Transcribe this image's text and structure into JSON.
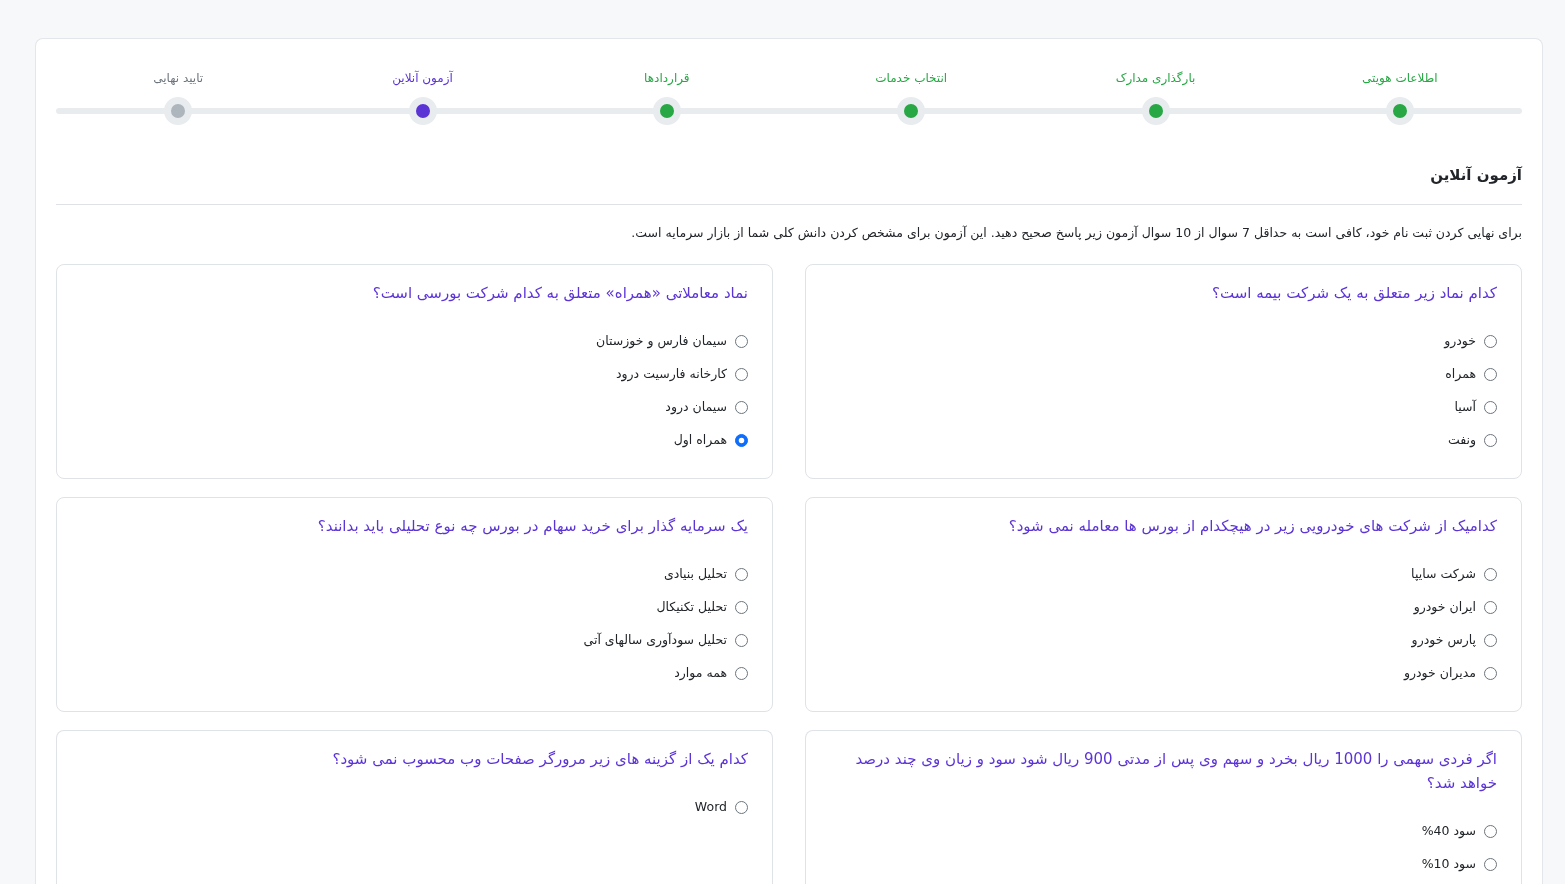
{
  "steps": [
    {
      "label": "اطلاعات هویتی",
      "completed": true,
      "selected": false
    },
    {
      "label": "بارگذاری مدارک",
      "completed": true,
      "selected": false
    },
    {
      "label": "انتخاب خدمات",
      "completed": true,
      "selected": false
    },
    {
      "label": "قراردادها",
      "completed": true,
      "selected": false
    },
    {
      "label": "آزمون آنلاین",
      "completed": false,
      "selected": true
    },
    {
      "label": "تایید نهایی",
      "completed": false,
      "selected": false
    }
  ],
  "section": {
    "title": "آزمون آنلاین",
    "intro": "برای نهایی کردن ثبت نام خود، کافی است به حداقل 7 سوال از 10 سوال آزمون زیر پاسخ صحیح دهید. این آزمون برای مشخص کردن دانش کلی شما از بازار سرمایه است."
  },
  "questions": [
    {
      "text": "کدام نماد زیر متعلق به یک شرکت بیمه است؟",
      "options": [
        {
          "label": "خودرو",
          "selected": false
        },
        {
          "label": "همراه",
          "selected": false
        },
        {
          "label": "آسیا",
          "selected": false
        },
        {
          "label": "ونفت",
          "selected": false
        }
      ]
    },
    {
      "text": "نماد معاملاتی «همراه» متعلق به کدام شرکت بورسی است؟",
      "options": [
        {
          "label": "سیمان فارس و خوزستان",
          "selected": false
        },
        {
          "label": "کارخانه فارسیت درود",
          "selected": false
        },
        {
          "label": "سیمان درود",
          "selected": false
        },
        {
          "label": "همراه اول",
          "selected": true
        }
      ]
    },
    {
      "text": "کدامیک از شرکت های خودرویی زیر در هیچکدام از بورس ها معامله نمی شود؟",
      "options": [
        {
          "label": "شرکت سایپا",
          "selected": false
        },
        {
          "label": "ایران خودرو",
          "selected": false
        },
        {
          "label": "پارس خودرو",
          "selected": false
        },
        {
          "label": "مدیران خودرو",
          "selected": false
        }
      ]
    },
    {
      "text": "یک سرمایه گذار برای خرید سهام در بورس چه نوع تحلیلی باید بدانند؟",
      "options": [
        {
          "label": "تحلیل بنیادی",
          "selected": false
        },
        {
          "label": "تحلیل تکنیکال",
          "selected": false
        },
        {
          "label": "تحلیل سودآوری سالهای آتی",
          "selected": false
        },
        {
          "label": "همه موارد",
          "selected": false
        }
      ]
    },
    {
      "text": "اگر فردی سهمی را 1000 ریال بخرد و سهم وی پس از مدتی 900 ریال شود سود و زیان وی چند درصد خواهد شد؟",
      "options": [
        {
          "label": "سود 40%",
          "selected": false
        },
        {
          "label": "سود 10%",
          "selected": false
        }
      ]
    },
    {
      "text": "کدام یک از گزینه های زیر مرورگر صفحات وب محسوب نمی شود؟",
      "options": [
        {
          "label": "Word",
          "selected": false
        }
      ]
    }
  ]
}
